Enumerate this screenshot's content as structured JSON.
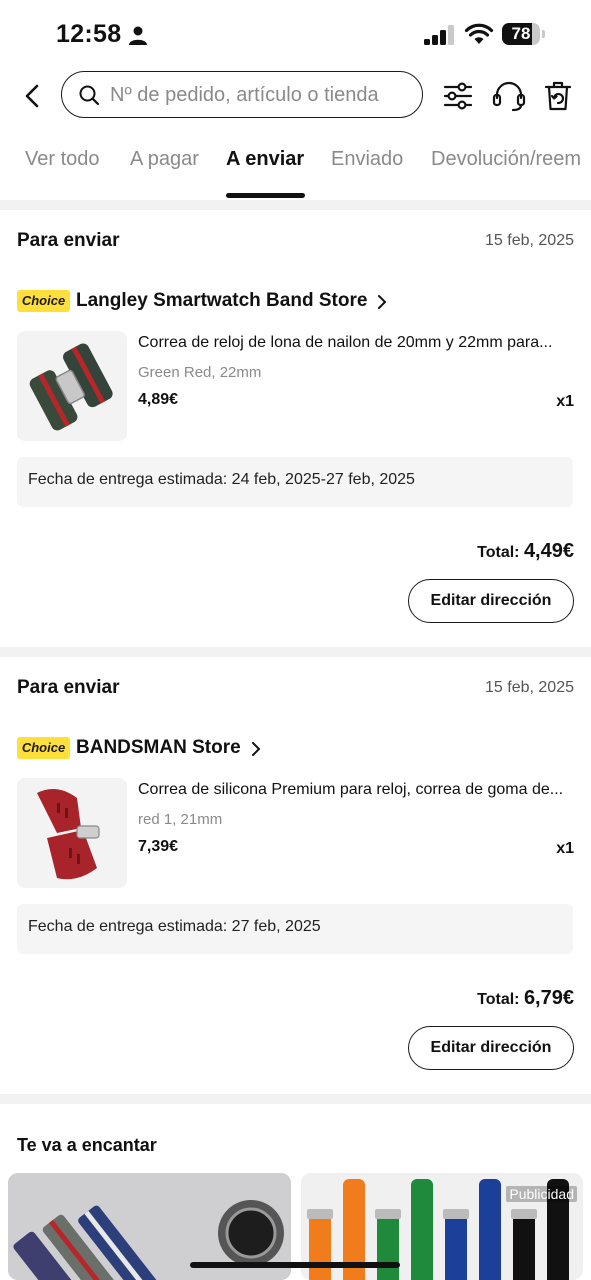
{
  "status_bar": {
    "time": "12:58",
    "battery": "78",
    "battery_percent": 78
  },
  "search": {
    "placeholder": "Nº de pedido, artículo o tienda"
  },
  "tabs": [
    {
      "label": "Ver todo"
    },
    {
      "label": "A pagar"
    },
    {
      "label": "A enviar",
      "active": true
    },
    {
      "label": "Enviado"
    },
    {
      "label": "Devolución/reem"
    }
  ],
  "orders": [
    {
      "status": "Para enviar",
      "date": "15 feb, 2025",
      "badge": "Choice",
      "store": "Langley Smartwatch Band Store",
      "item": {
        "title": "Correa de reloj de lona de nailon de 20mm y 22mm para...",
        "variant": "Green Red, 22mm",
        "price": "4,89€",
        "qty": "x1"
      },
      "delivery": "Fecha de entrega estimada: 24 feb, 2025-27 feb, 2025",
      "total_label": "Total:",
      "total": "4,49€",
      "button": "Editar dirección"
    },
    {
      "status": "Para enviar",
      "date": "15 feb, 2025",
      "badge": "Choice",
      "store": "BANDSMAN Store",
      "item": {
        "title": "Correa de silicona Premium para reloj, correa de goma de...",
        "variant": "red 1, 21mm",
        "price": "7,39€",
        "qty": "x1"
      },
      "delivery": "Fecha de entrega estimada: 27 feb, 2025",
      "total_label": "Total:",
      "total": "6,79€",
      "button": "Editar dirección"
    }
  ],
  "recommendations": {
    "title": "Te va a encantar",
    "ad_label": "Publicidad"
  },
  "colors": {
    "choice_badge": "#ffdf3b",
    "page_gap": "#f2f2f2",
    "delivery_bg": "#f5f5f5"
  }
}
